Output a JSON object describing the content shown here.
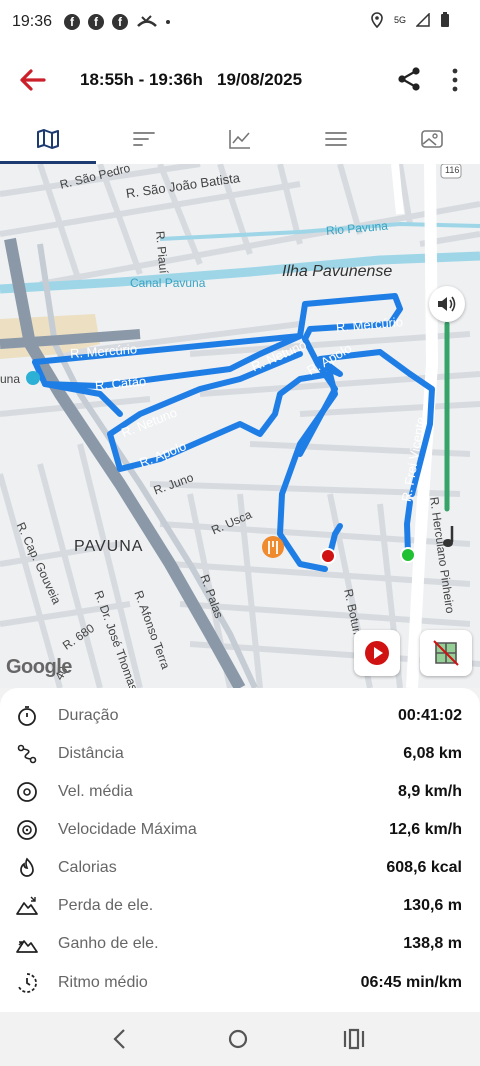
{
  "status_bar": {
    "time": "19:36",
    "network": "5G"
  },
  "header": {
    "title": "18:55h - 19:36h   19/08/2025"
  },
  "tabs": [
    "map-icon",
    "segments-icon",
    "chart-icon",
    "list-icon",
    "photo-icon"
  ],
  "map": {
    "labels": {
      "sao_pedro": "R. São Pedro",
      "sao_joao": "R. São João Batista",
      "piaui": "R. Piauí",
      "rio_pavuna": "Rio Pavuna",
      "canal_pavuna": "Canal Pavuna",
      "ilha": "Ilha Pavunense",
      "mercurio_1": "R. Mercúrio",
      "mercurio_2": "R. Mercúrio",
      "una": "una",
      "catao": "R. Catão",
      "netuno_1": "R. Netuno",
      "netuno_2": "R. Netuno",
      "apolo_1": "R. Apolo",
      "apolo_2": "R. Apolo",
      "juno": "R. Juno",
      "usca": "R. Usca",
      "pavuna": "PAVUNA",
      "cap_gouveia": "R. Cap. Gouveia",
      "dr_jose_thomas": "R. Dr. José Thomas",
      "afonso_terra": "R. Afonso Terra",
      "palas": "R. Palas",
      "r680": "R. 680",
      "r40": "40",
      "botumi": "R. Botumi",
      "frei_vicente": "R. Frei Vicente",
      "herculano": "R. Herculano Pinheiro",
      "road_shield": "116"
    },
    "attribution": "Google"
  },
  "stats": [
    {
      "icon": "stopwatch-icon",
      "label": "Duração",
      "value": "00:41:02"
    },
    {
      "icon": "route-icon",
      "label": "Distância",
      "value": "6,08 km"
    },
    {
      "icon": "speed-icon",
      "label": "Vel. média",
      "value": "8,9 km/h"
    },
    {
      "icon": "max-speed-icon",
      "label": "Velocidade Máxima",
      "value": "12,6 km/h"
    },
    {
      "icon": "flame-icon",
      "label": "Calorias",
      "value": "608,6 kcal"
    },
    {
      "icon": "elevation-loss-icon",
      "label": "Perda de ele.",
      "value": "130,6 m"
    },
    {
      "icon": "elevation-gain-icon",
      "label": "Ganho de ele.",
      "value": "138,8 m"
    },
    {
      "icon": "pace-icon",
      "label": "Ritmo médio",
      "value": "06:45 min/km"
    }
  ]
}
